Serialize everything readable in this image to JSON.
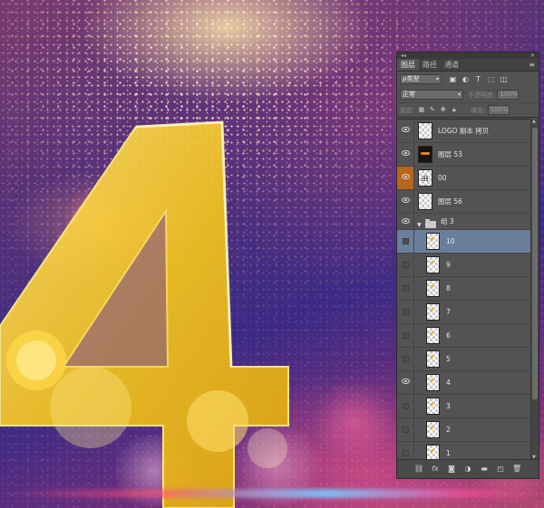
{
  "panel": {
    "tabs": [
      "图层",
      "路径",
      "通道"
    ],
    "filter_kind": "ρ类型",
    "blend_mode": "正常",
    "opacity_label": "不透明度:",
    "opacity_value": "100%",
    "lock_label": "锁定:",
    "fill_label": "填充:",
    "fill_value": "100%"
  },
  "layers": [
    {
      "name": "LOGO 副本 拷贝",
      "visible": true
    },
    {
      "name": "图层 53",
      "visible": true
    },
    {
      "name": "00",
      "visible": true
    },
    {
      "name": "图层 56",
      "visible": true
    },
    {
      "name": "组 3",
      "visible": true,
      "type": "group"
    },
    {
      "name": "10",
      "visible": false,
      "selected": true
    },
    {
      "name": "9",
      "visible": false
    },
    {
      "name": "8",
      "visible": false
    },
    {
      "name": "7",
      "visible": false
    },
    {
      "name": "6",
      "visible": false
    },
    {
      "name": "5",
      "visible": false
    },
    {
      "name": "4",
      "visible": true
    },
    {
      "name": "3",
      "visible": false
    },
    {
      "name": "2",
      "visible": false
    },
    {
      "name": "1",
      "visible": false
    }
  ],
  "icons": {
    "panel_menu": "menu-icon",
    "footer": [
      "link-icon",
      "fx-icon",
      "mask-icon",
      "adjustment-icon",
      "new-group-icon",
      "new-layer-icon",
      "trash-icon"
    ]
  },
  "colors": {
    "panel_bg": "#535353",
    "selection": "#6a7f9a",
    "eye_active_bg": "#b8661a",
    "gold": "#f2c21f"
  }
}
